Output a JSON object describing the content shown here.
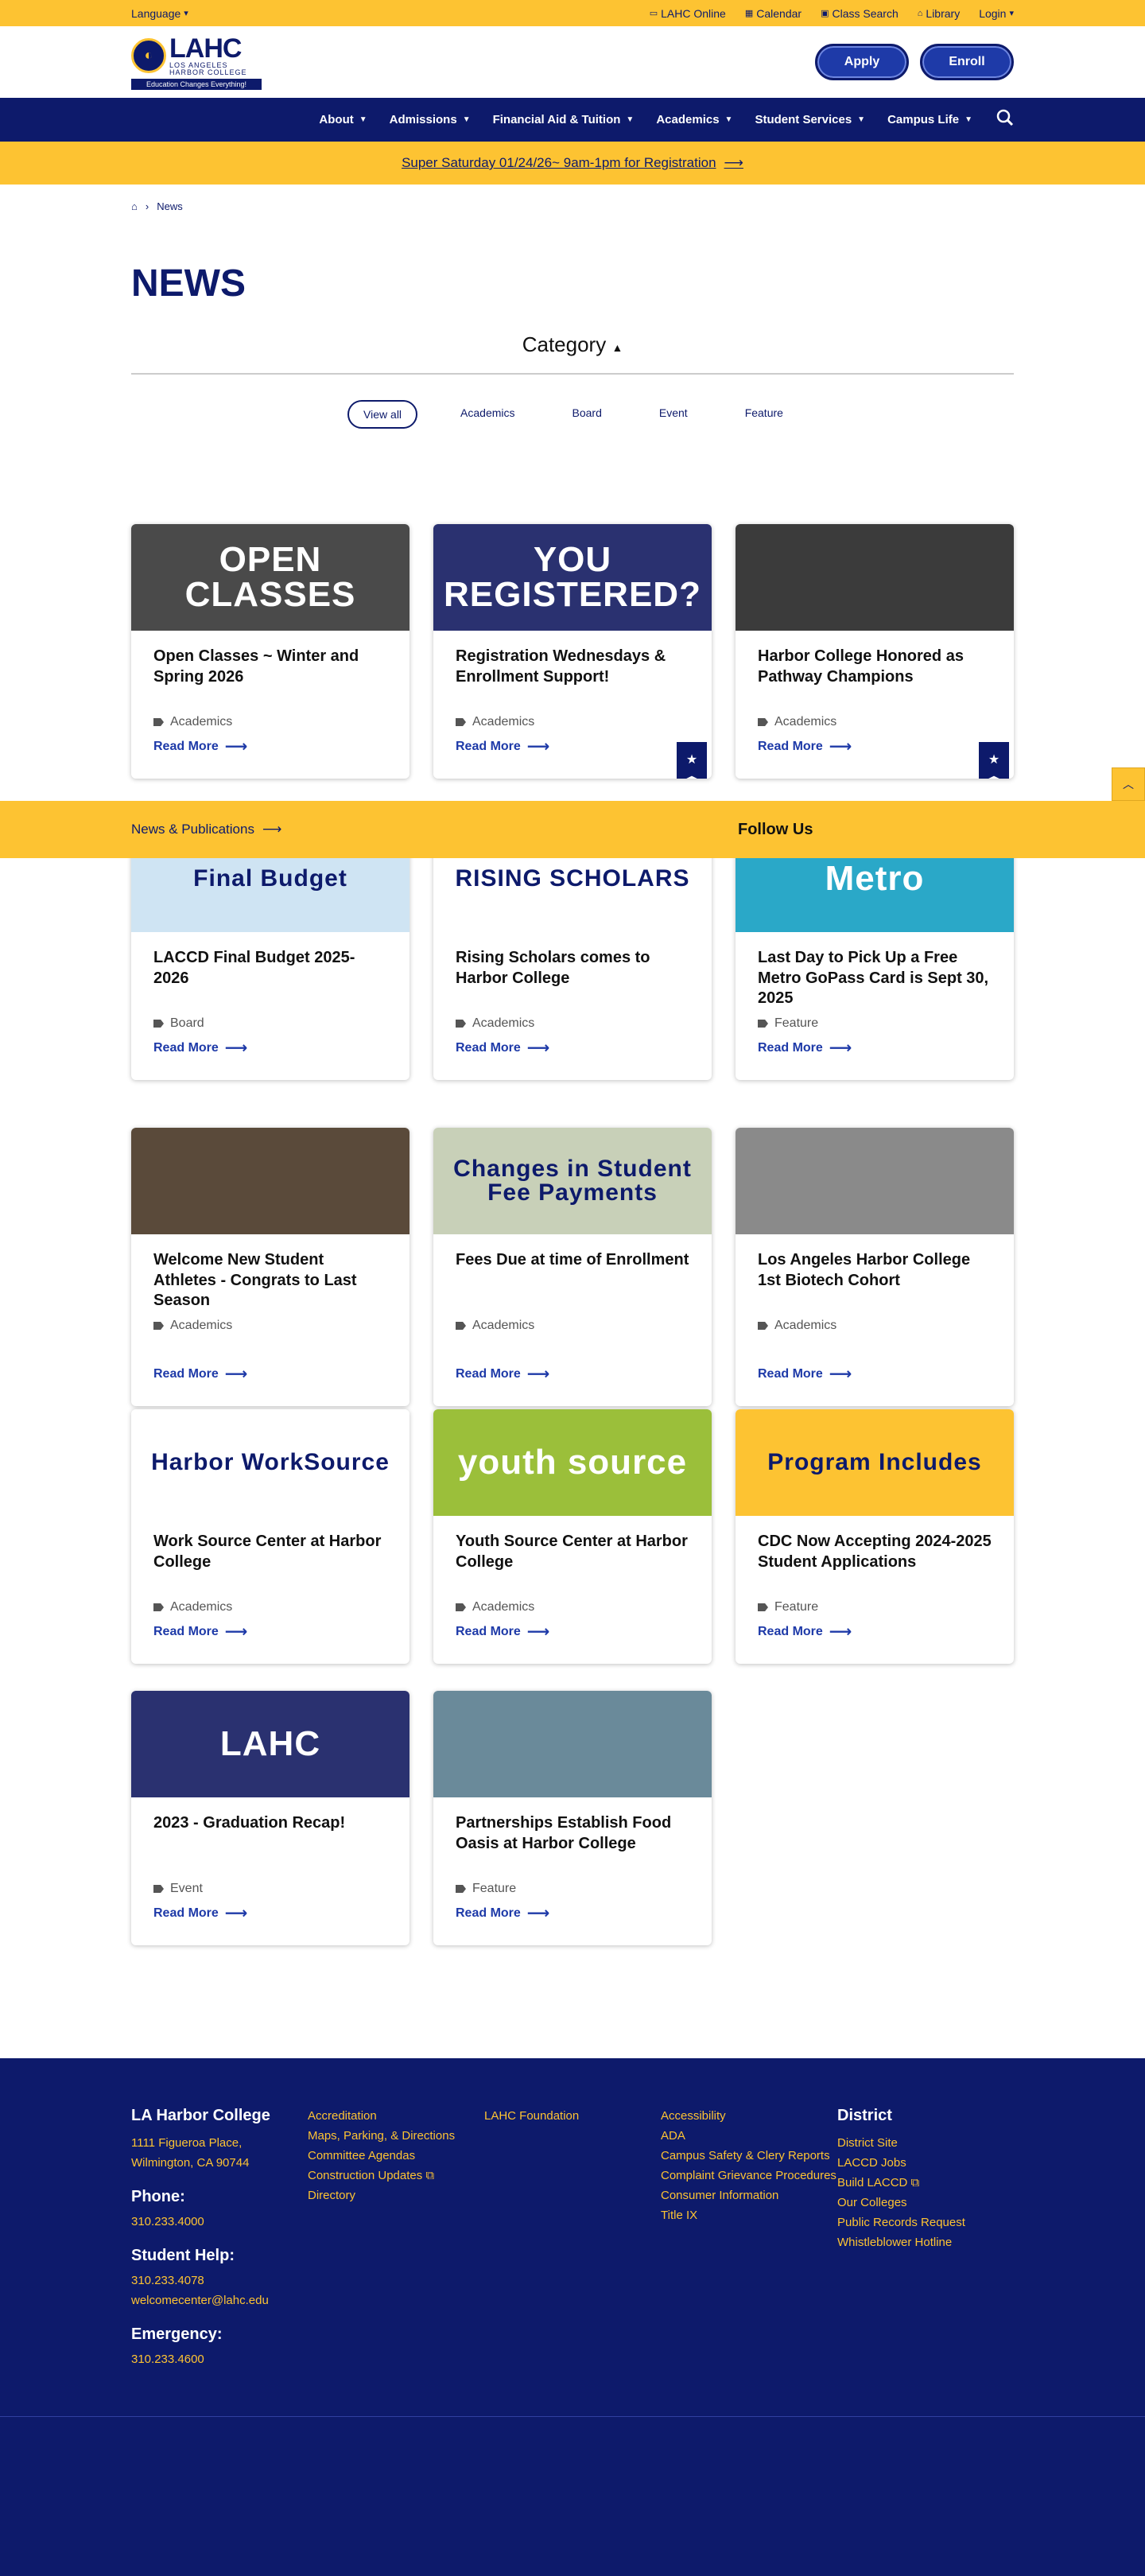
{
  "utility": {
    "language": "Language",
    "links": [
      "LAHC Online",
      "Calendar",
      "Class Search",
      "Library",
      "Login"
    ]
  },
  "logo": {
    "name": "LAHC",
    "line1": "LOS ANGELES",
    "line2": "HARBOR COLLEGE",
    "tagline": "Education Changes Everything!"
  },
  "cta": {
    "apply": "Apply",
    "enroll": "Enroll"
  },
  "nav": [
    "About",
    "Admissions",
    "Financial Aid & Tuition",
    "Academics",
    "Student Services",
    "Campus Life"
  ],
  "announcement": "Super Saturday 01/24/26~ 9am-1pm for Registration",
  "breadcrumb": {
    "current": "News"
  },
  "page": {
    "title": "NEWS"
  },
  "category": {
    "label": "Category",
    "filters": [
      "View all",
      "Academics",
      "Board",
      "Event",
      "Feature"
    ]
  },
  "read_more": "Read More",
  "cards": [
    {
      "title": "Open Classes ~ Winter and Spring 2026",
      "category": "Academics",
      "image_text": "OPEN CLASSES",
      "bg": "#4a4a4a",
      "bookmark": false
    },
    {
      "title": "Registration Wednesdays & Enrollment Support!",
      "category": "Academics",
      "image_text": "YOU REGISTERED?",
      "bg": "#2a3170",
      "bookmark": true
    },
    {
      "title": "Harbor College Honored as Pathway Champions",
      "category": "Academics",
      "image_text": "",
      "bg": "#3b3b3b",
      "bookmark": true
    },
    {
      "title": "LACCD Final Budget 2025-2026",
      "category": "Board",
      "image_text": "Final Budget",
      "bg": "#cfe4f3",
      "bookmark": false
    },
    {
      "title": "Rising Scholars comes to Harbor College",
      "category": "Academics",
      "image_text": "RISING SCHOLARS",
      "bg": "#ffffff",
      "bookmark": false
    },
    {
      "title": "Last Day to Pick Up a Free Metro GoPass Card is Sept 30, 2025",
      "category": "Feature",
      "image_text": "Metro",
      "bg": "#2aa8c8",
      "bookmark": false
    },
    {
      "title": "Welcome New Student Athletes - Congrats to Last Season",
      "category": "Academics",
      "image_text": "",
      "bg": "#5a4a3a",
      "bookmark": false
    },
    {
      "title": "Fees Due at time of Enrollment",
      "category": "Academics",
      "image_text": "Changes in Student Fee Payments",
      "bg": "#c8d0b8",
      "bookmark": false
    },
    {
      "title": "Los Angeles Harbor College 1st Biotech Cohort",
      "category": "Academics",
      "image_text": "",
      "bg": "#8a8a8a",
      "bookmark": false
    },
    {
      "title": "Work Source Center at Harbor College",
      "category": "Academics",
      "image_text": "Harbor WorkSource",
      "bg": "#ffffff",
      "bookmark": false
    },
    {
      "title": "Youth Source Center at Harbor College",
      "category": "Academics",
      "image_text": "youth source",
      "bg": "#9bbf3a",
      "bookmark": false
    },
    {
      "title": "CDC Now Accepting 2024-2025 Student Applications",
      "category": "Feature",
      "image_text": "Program Includes",
      "bg": "#fdc332",
      "bookmark": false
    },
    {
      "title": "2023 - Graduation Recap!",
      "category": "Event",
      "image_text": "LAHC",
      "bg": "#2a3170",
      "bookmark": false
    },
    {
      "title": "Partnerships Establish Food Oasis at Harbor College",
      "category": "Feature",
      "image_text": "",
      "bg": "#6a8a9a",
      "bookmark": false
    }
  ],
  "sticky": {
    "left": "News & Publications",
    "right": "Follow Us"
  },
  "footer": {
    "college": "LA Harbor College",
    "address1": "1111 Figueroa Place,",
    "address2": "Wilmington, CA 90744",
    "phone_label": "Phone:",
    "phone": "310.233.4000",
    "help_label": "Student Help:",
    "help_phone": "310.233.4078",
    "help_email": "welcomecenter@lahc.edu",
    "emergency_label": "Emergency:",
    "emergency_phone": "310.233.4600",
    "col2": [
      "Accreditation",
      "Maps, Parking, & Directions",
      "Committee Agendas",
      "Construction Updates",
      "Directory"
    ],
    "col3": [
      "LAHC Foundation"
    ],
    "col4": [
      "Accessibility",
      "ADA",
      "Campus Safety & Clery Reports",
      "Complaint Grievance Procedures",
      "Consumer Information",
      "Title IX"
    ],
    "district_label": "District",
    "col5": [
      "District Site",
      "LACCD Jobs",
      "Build LACCD",
      "Our Colleges",
      "Public Records Request",
      "Whistleblower Hotline"
    ]
  }
}
